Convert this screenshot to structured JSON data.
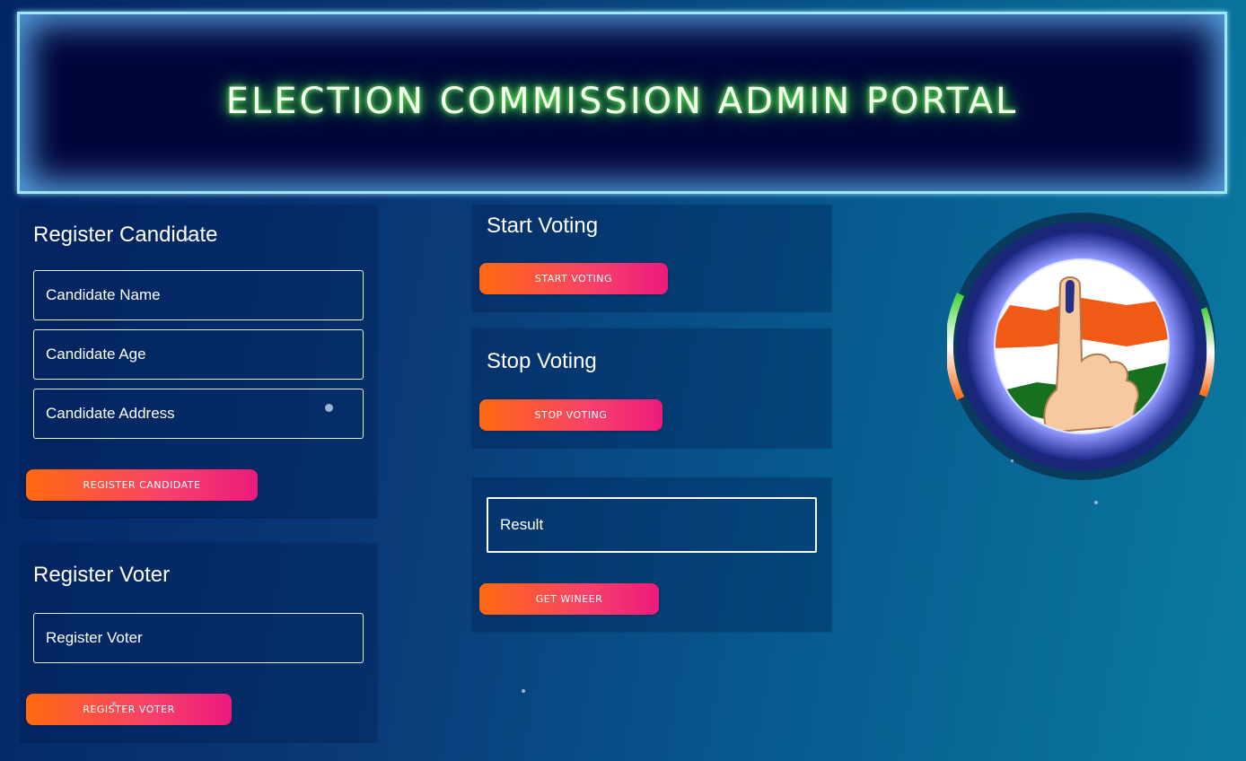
{
  "header": {
    "title": "ELECTION COMMISSION ADMIN PORTAL"
  },
  "register_candidate": {
    "title": "Register Candidate",
    "name_placeholder": "Candidate Name",
    "age_placeholder": "Candidate Age",
    "address_placeholder": "Candidate Address",
    "button_label": "REGISTER CANDIDATE"
  },
  "register_voter": {
    "title": "Register Voter",
    "voter_placeholder": "Register Voter",
    "button_label": "REGISTER VOTER"
  },
  "start_voting": {
    "title": "Start Voting",
    "button_label": "START VOTING"
  },
  "stop_voting": {
    "title": "Stop Voting",
    "button_label": "STOP VOTING"
  },
  "result": {
    "placeholder": "Result",
    "button_label": "GET WINEER"
  },
  "emblem": {
    "icon": "voting-finger-flag-icon"
  },
  "colors": {
    "button_start": "#ff6a10",
    "button_end": "#ec1b7c",
    "header_glow": "#3fe23a",
    "header_border": "#9fe6ff",
    "saffron": "#ff6a1a",
    "green": "#1a7a1e"
  }
}
